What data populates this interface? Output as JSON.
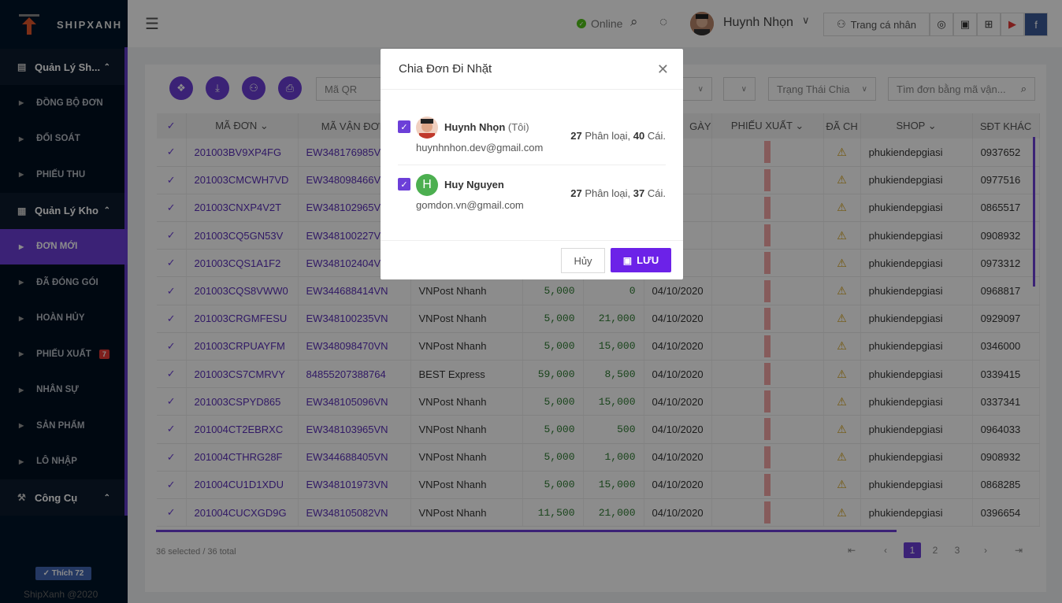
{
  "brand": {
    "name": "SHIPXANH",
    "like_label": "✓ Thích 72",
    "copyright": "ShipXanh @2020"
  },
  "sidebar": {
    "group1": "Quản Lý Sh...",
    "items1": [
      "ĐỒNG BỘ ĐƠN",
      "ĐỐI SOÁT",
      "PHIẾU THU"
    ],
    "group2": "Quản Lý Kho",
    "items2": [
      "ĐƠN MỚI",
      "ĐÃ ĐÓNG GÓI",
      "HOÀN HỦY",
      "PHIẾU XUẤT",
      "NHÂN SỰ",
      "SẢN PHẨM",
      "LÔ NHẬP"
    ],
    "phieu_xuat_badge": "7",
    "group3": "Công Cụ"
  },
  "header": {
    "status": "Online",
    "user_name": "Huynh Nhọn",
    "profile_button": "Trang cá nhân"
  },
  "filters": {
    "qr": "Mã QR",
    "trang_thai": "Trạng Thái Chia",
    "search_placeholder": "Tìm đơn bằng mã vận..."
  },
  "table": {
    "headers": [
      "MÃ ĐƠN",
      "MÃ VẬN ĐƠN",
      "",
      "",
      "",
      "GÀY",
      "PHIẾU XUẤT",
      "ĐÃ CH",
      "SHOP",
      "SĐT KHÁC"
    ],
    "rows": [
      {
        "code": "201003BV9XP4FG",
        "vd": "EW348176985V",
        "carrier": "",
        "a": "",
        "b": "",
        "date": "2020",
        "shop": "phukiendepgiasi",
        "phone": "0937652"
      },
      {
        "code": "201003CMCWH7VD",
        "vd": "EW348098466V",
        "carrier": "",
        "a": "",
        "b": "",
        "date": "2020",
        "shop": "phukiendepgiasi",
        "phone": "0977516"
      },
      {
        "code": "201003CNXP4V2T",
        "vd": "EW348102965V",
        "carrier": "",
        "a": "",
        "b": "",
        "date": "2020",
        "shop": "phukiendepgiasi",
        "phone": "0865517"
      },
      {
        "code": "201003CQ5GN53V",
        "vd": "EW348100227V",
        "carrier": "",
        "a": "",
        "b": "",
        "date": "2020",
        "shop": "phukiendepgiasi",
        "phone": "0908932"
      },
      {
        "code": "201003CQS1A1F2",
        "vd": "EW348102404V",
        "carrier": "",
        "a": "",
        "b": "",
        "date": "2020",
        "shop": "phukiendepgiasi",
        "phone": "0973312"
      },
      {
        "code": "201003CQS8VWW0",
        "vd": "EW344688414VN",
        "carrier": "VNPost Nhanh",
        "a": "5,000",
        "b": "0",
        "date": "04/10/2020",
        "shop": "phukiendepgiasi",
        "phone": "0968817"
      },
      {
        "code": "201003CRGMFESU",
        "vd": "EW348100235VN",
        "carrier": "VNPost Nhanh",
        "a": "5,000",
        "b": "21,000",
        "date": "04/10/2020",
        "shop": "phukiendepgiasi",
        "phone": "0929097"
      },
      {
        "code": "201003CRPUAYFM",
        "vd": "EW348098470VN",
        "carrier": "VNPost Nhanh",
        "a": "5,000",
        "b": "15,000",
        "date": "04/10/2020",
        "shop": "phukiendepgiasi",
        "phone": "0346000"
      },
      {
        "code": "201003CS7CMRVY",
        "vd": "84855207388764",
        "carrier": "BEST Express",
        "a": "59,000",
        "b": "8,500",
        "date": "04/10/2020",
        "shop": "phukiendepgiasi",
        "phone": "0339415"
      },
      {
        "code": "201003CSPYD865",
        "vd": "EW348105096VN",
        "carrier": "VNPost Nhanh",
        "a": "5,000",
        "b": "15,000",
        "date": "04/10/2020",
        "shop": "phukiendepgiasi",
        "phone": "0337341"
      },
      {
        "code": "201004CT2EBRXC",
        "vd": "EW348103965VN",
        "carrier": "VNPost Nhanh",
        "a": "5,000",
        "b": "500",
        "date": "04/10/2020",
        "shop": "phukiendepgiasi",
        "phone": "0964033"
      },
      {
        "code": "201004CTHRG28F",
        "vd": "EW344688405VN",
        "carrier": "VNPost Nhanh",
        "a": "5,000",
        "b": "1,000",
        "date": "04/10/2020",
        "shop": "phukiendepgiasi",
        "phone": "0908932"
      },
      {
        "code": "201004CU1D1XDU",
        "vd": "EW348101973VN",
        "carrier": "VNPost Nhanh",
        "a": "5,000",
        "b": "15,000",
        "date": "04/10/2020",
        "shop": "phukiendepgiasi",
        "phone": "0868285"
      },
      {
        "code": "201004CUCXGD9G",
        "vd": "EW348105082VN",
        "carrier": "VNPost Nhanh",
        "a": "11,500",
        "b": "21,000",
        "date": "04/10/2020",
        "shop": "phukiendepgiasi",
        "phone": "0396654"
      }
    ]
  },
  "footer": {
    "selected": "36 selected / 36 total",
    "pages": [
      "1",
      "2",
      "3"
    ]
  },
  "modal": {
    "title": "Chia Đơn Đi Nhặt",
    "users": [
      {
        "name": "Huynh Nhọn",
        "tag": "(Tôi)",
        "email": "huynhnhon.dev@gmail.com",
        "types": "27",
        "types_label": "Phân loại,",
        "items": "40",
        "items_label": "Cái."
      },
      {
        "name": "Huy Nguyen",
        "initial": "H",
        "email": "gomdon.vn@gmail.com",
        "types": "27",
        "types_label": "Phân loại,",
        "items": "37",
        "items_label": "Cái."
      }
    ],
    "cancel": "Hủy",
    "save": "LƯU"
  },
  "colors": {
    "accent": "#6c3fd8",
    "sidebar": "#001529",
    "online": "#52c41a"
  }
}
